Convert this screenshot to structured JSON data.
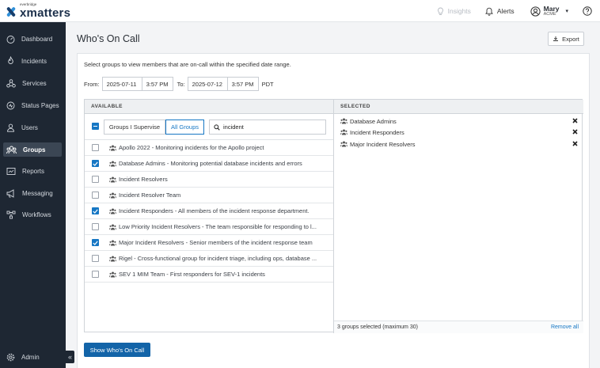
{
  "brand": {
    "small": "everbridge",
    "name": "xmatters"
  },
  "topbar": {
    "insights": "Insights",
    "alerts": "Alerts",
    "user_name": "Mary",
    "user_org": "ACME",
    "caret": "▾"
  },
  "sidebar": {
    "items": [
      {
        "label": "Dashboard",
        "icon": "dashboard-icon"
      },
      {
        "label": "Incidents",
        "icon": "fire-icon"
      },
      {
        "label": "Services",
        "icon": "services-icon"
      },
      {
        "label": "Status Pages",
        "icon": "status-icon"
      },
      {
        "label": "Users",
        "icon": "user-icon"
      },
      {
        "label": "Groups",
        "icon": "groups-icon",
        "active": true
      },
      {
        "label": "Reports",
        "icon": "reports-icon"
      },
      {
        "label": "Messaging",
        "icon": "megaphone-icon"
      },
      {
        "label": "Workflows",
        "icon": "workflow-icon"
      }
    ],
    "admin": "Admin",
    "collapse": "«"
  },
  "page": {
    "title": "Who's On Call",
    "export_label": "Export",
    "intro": "Select groups to view members that are on-call within the specified date range.",
    "range": {
      "from_label": "From:",
      "from_date": "2025-07-11",
      "from_time": "3:57 PM",
      "to_label": "To:",
      "to_date": "2025-07-12",
      "to_time": "3:57 PM",
      "tz": "PDT"
    }
  },
  "available": {
    "header": "AVAILABLE",
    "seg_supervise": "Groups I Supervise",
    "seg_all": "All Groups",
    "search_value": "incident",
    "rows": [
      {
        "label": "Apollo 2022 - Monitoring incidents for the Apollo project",
        "checked": false
      },
      {
        "label": "Database Admins - Monitoring potential database incidents and errors",
        "checked": true
      },
      {
        "label": "Incident Resolvers",
        "checked": false
      },
      {
        "label": "Incident Resolver Team",
        "checked": false
      },
      {
        "label": "Incident Responders - All members of the incident response department.",
        "checked": true
      },
      {
        "label": "Low Priority Incident Resolvers - The team responsible for responding to l...",
        "checked": false
      },
      {
        "label": "Major Incident Resolvers - Senior members of the incident response team",
        "checked": true
      },
      {
        "label": "Rigel - Cross-functional group for incident triage, including ops, database ...",
        "checked": false
      },
      {
        "label": "SEV 1 MIM Team - First responders for SEV-1 incidents",
        "checked": false
      }
    ]
  },
  "selected": {
    "header": "SELECTED",
    "rows": [
      {
        "label": "Database Admins"
      },
      {
        "label": "Incident Responders"
      },
      {
        "label": "Major Incident Resolvers"
      }
    ],
    "summary": "3 groups selected (maximum 30)",
    "remove_all": "Remove all"
  },
  "actions": {
    "show_label": "Show Who's On Call"
  },
  "colors": {
    "accent": "#1677c4",
    "sidebar": "#1e2733",
    "primary_button": "#1364a8"
  }
}
